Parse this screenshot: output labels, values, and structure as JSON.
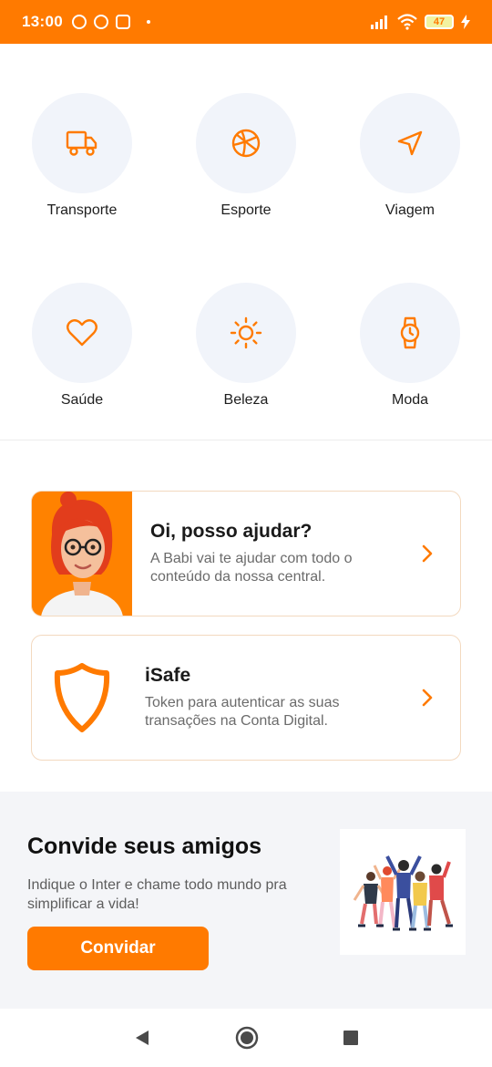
{
  "status_bar": {
    "time": "13:00",
    "battery": "47",
    "notification_icons": [
      "notification-icon",
      "notification-icon",
      "notification-icon"
    ]
  },
  "categories": [
    {
      "label": "Transporte",
      "icon": "truck-icon"
    },
    {
      "label": "Esporte",
      "icon": "basketball-icon"
    },
    {
      "label": "Viagem",
      "icon": "navigation-icon"
    },
    {
      "label": "Saúde",
      "icon": "heart-icon"
    },
    {
      "label": "Beleza",
      "icon": "sun-icon"
    },
    {
      "label": "Moda",
      "icon": "watch-icon"
    }
  ],
  "help_card": {
    "title": "Oi, posso ajudar?",
    "desc_line1": "A Babi vai te ajudar com todo o",
    "desc_line2": "conteúdo da nossa central."
  },
  "isafe_card": {
    "title": "iSafe",
    "desc_line1": "Token para autenticar as suas",
    "desc_line2": "transações na Conta Digital."
  },
  "invite": {
    "title": "Convide seus amigos",
    "desc_line1": "Indique o Inter e chame todo mundo pra",
    "desc_line2": "simplificar a vida!",
    "button": "Convidar"
  },
  "colors": {
    "accent": "#ff7a00",
    "icon_bg": "#f1f4fa",
    "card_border": "#f3d9bf"
  }
}
